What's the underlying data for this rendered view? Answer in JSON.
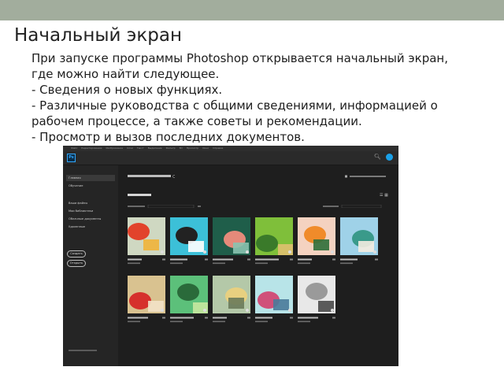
{
  "slide": {
    "title": "Начальный экран",
    "lines": [
      "При запуске программы Photoshop открывается начальный экран,",
      "где можно найти следующее.",
      "- Сведения о новых функциях.",
      "- Различные руководства с общими сведениями, информацией о",
      "рабочем процессе, а также советы и рекомендации.",
      "- Просмотр и вызов последних документов."
    ]
  },
  "photoshop": {
    "logo": "Ps",
    "search_icon": "search-icon",
    "menu": [
      "Файл",
      "Редактирование",
      "Изображение",
      "Слои",
      "Текст",
      "Выделение",
      "Фильтр",
      "3D",
      "Просмотр",
      "Окно",
      "Справка"
    ],
    "sidebar": {
      "items": [
        "Главная",
        "Обучение"
      ],
      "sub_items": [
        "Ваши файлы",
        "Мои библиотеки",
        "Облачные документы",
        "Удаленные"
      ],
      "buttons": [
        "Создать",
        "Открыть"
      ]
    },
    "thumbnails": [
      {
        "row": 1,
        "col": 1,
        "palette": [
          "#cfd8c2",
          "#e2432c",
          "#f0b43a"
        ]
      },
      {
        "row": 1,
        "col": 2,
        "palette": [
          "#3cc0d8",
          "#222222",
          "#ffffff"
        ]
      },
      {
        "row": 1,
        "col": 3,
        "palette": [
          "#1f5e4a",
          "#e58a7a",
          "#89c3b0"
        ]
      },
      {
        "row": 1,
        "col": 4,
        "palette": [
          "#7fbf3a",
          "#3a7a2a",
          "#e0c070"
        ]
      },
      {
        "row": 1,
        "col": 5,
        "palette": [
          "#f4d2c0",
          "#f08b2a",
          "#2f6e3a"
        ]
      },
      {
        "row": 1,
        "col": 6,
        "palette": [
          "#9fd2e8",
          "#3a9a8a",
          "#f4ece0"
        ]
      },
      {
        "row": 2,
        "col": 1,
        "palette": [
          "#d9c290",
          "#d6302c",
          "#f2e2c8"
        ]
      },
      {
        "row": 2,
        "col": 2,
        "palette": [
          "#5cc07a",
          "#2a6a3a",
          "#c8e8a0"
        ]
      },
      {
        "row": 2,
        "col": 3,
        "palette": [
          "#b4c8a8",
          "#e8d080",
          "#6a7a5a"
        ]
      },
      {
        "row": 2,
        "col": 4,
        "palette": [
          "#b8e4e8",
          "#d0507a",
          "#4a7a9a"
        ]
      },
      {
        "row": 2,
        "col": 5,
        "palette": [
          "#e8e8e8",
          "#9a9a9a",
          "#4a4a4a"
        ]
      }
    ]
  }
}
